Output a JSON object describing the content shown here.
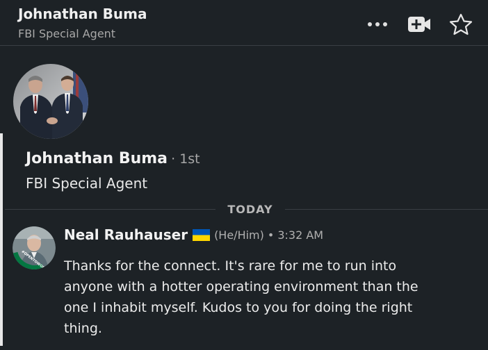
{
  "header": {
    "name": "Johnathan Buma",
    "title": "FBI Special Agent",
    "actions": [
      {
        "icon": "more-icon"
      },
      {
        "icon": "video-add-icon"
      },
      {
        "icon": "star-icon"
      }
    ]
  },
  "profile": {
    "name": "Johnathan Buma",
    "degree": "· 1st",
    "title": "FBI Special Agent"
  },
  "divider": {
    "label": "TODAY"
  },
  "message": {
    "sender": "Neal Rauhauser",
    "flag_icon": "ukraine-flag-icon",
    "pronouns": "(He/Him)",
    "separator": "•",
    "time": "3:32 AM",
    "body": "Thanks for the connect. It's rare for me to run into anyone with a hotter operating environment than the one I inhabit myself. Kudos to you for doing the right thing.",
    "avatar_badge_text": "#OPENTOWORK"
  },
  "colors": {
    "background": "#1d2226",
    "flag_blue": "#0057b7",
    "flag_yellow": "#ffd700",
    "open_to_work_green": "#057642"
  }
}
